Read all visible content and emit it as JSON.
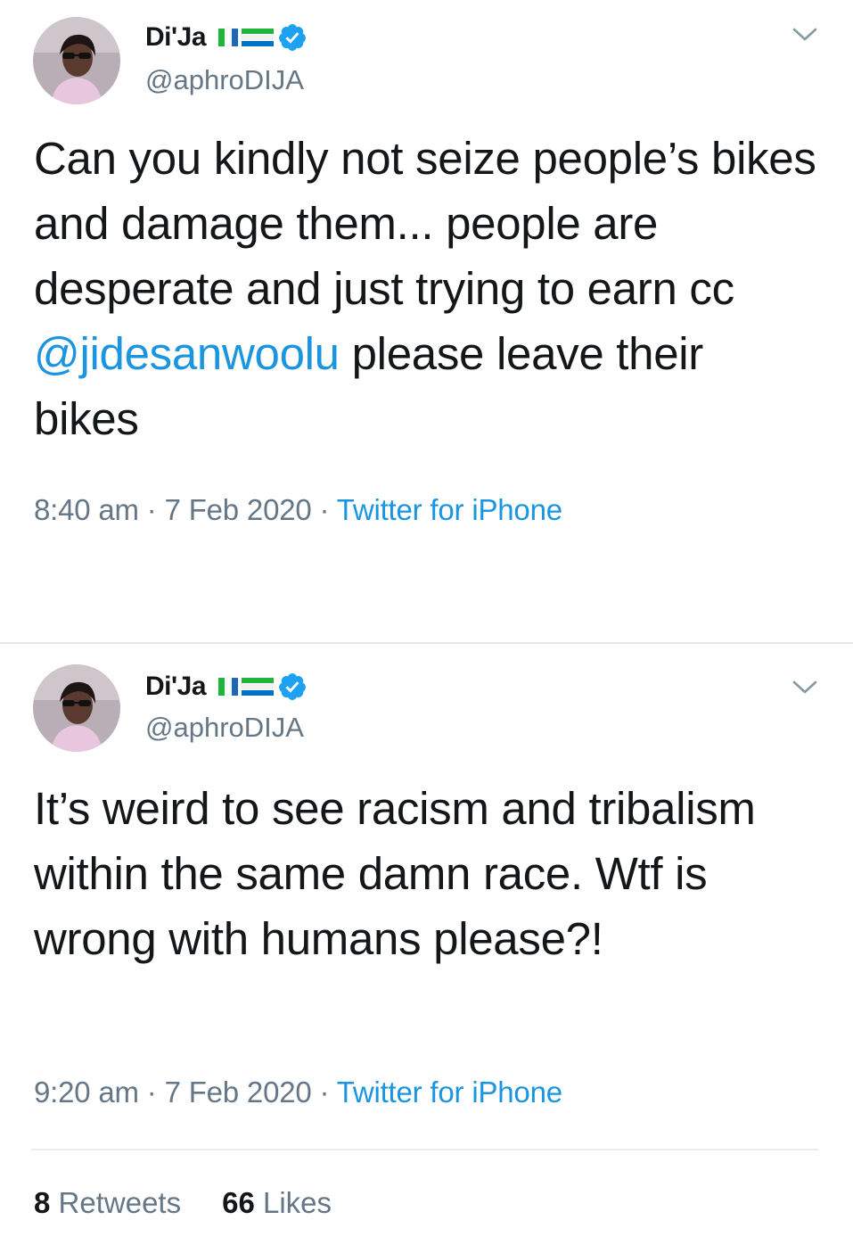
{
  "colors": {
    "text_primary": "#14171a",
    "text_secondary": "#657786",
    "link": "#1b95e0",
    "divider": "#e1e8ed",
    "verified_badge": "#1da1f2"
  },
  "tweets": [
    {
      "author": {
        "display_name": "Di'Ja",
        "flag_icon": "sierra-leone-flag-icon",
        "verified_icon": "verified-badge-icon",
        "handle": "@aphroDIJA"
      },
      "text": {
        "before_mention": "Can you kindly not seize people’s bikes and damage them... people are desperate and just trying to earn cc ",
        "mention": "@jidesanwoolu",
        "after_mention": " please leave their bikes"
      },
      "time": "8:40 am",
      "separator_1": " · ",
      "date": "7 Feb 2020",
      "separator_2": " · ",
      "source": "Twitter for iPhone"
    },
    {
      "author": {
        "display_name": "Di'Ja",
        "flag_icon": "sierra-leone-flag-icon",
        "verified_icon": "verified-badge-icon",
        "handle": "@aphroDIJA"
      },
      "text": {
        "body": "It’s weird to see racism and tribalism within the same damn race. Wtf is wrong with humans please?!"
      },
      "time": "9:20 am",
      "separator_1": " · ",
      "date": "7 Feb 2020",
      "separator_2": " · ",
      "source": "Twitter for iPhone",
      "stats": {
        "retweets_count": "8",
        "retweets_label": " Retweets",
        "likes_count": "66",
        "likes_label": " Likes"
      }
    }
  ]
}
